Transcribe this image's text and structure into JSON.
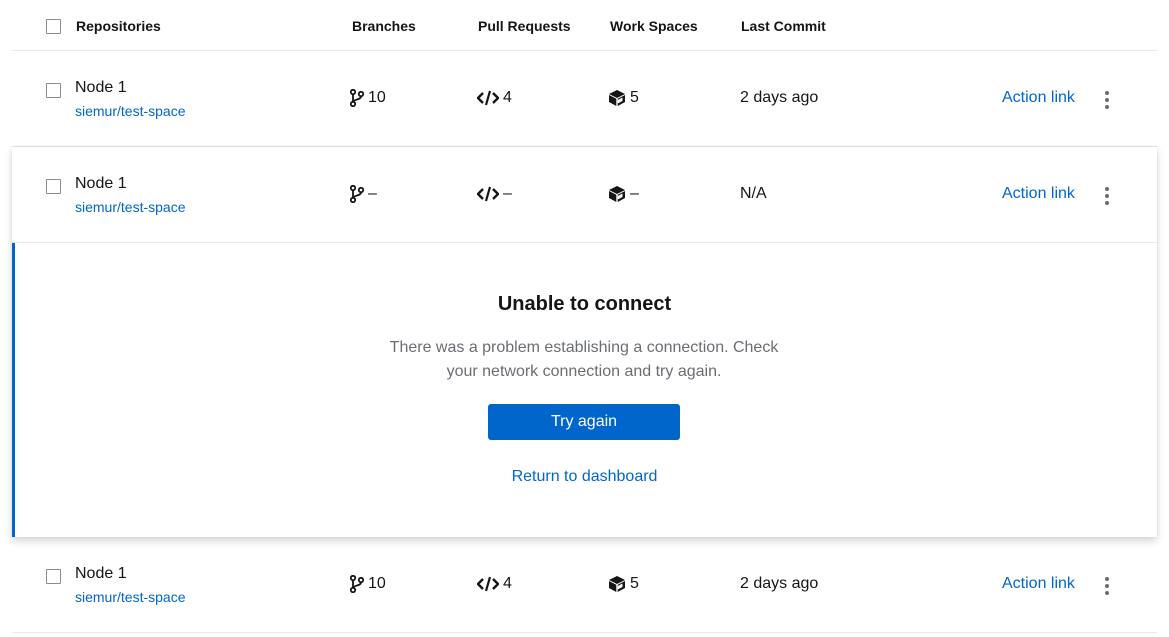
{
  "header": {
    "col_repositories": "Repositories",
    "col_branches": "Branches",
    "col_pull_requests": "Pull Requests",
    "col_work_spaces": "Work Spaces",
    "col_last_commit": "Last Commit"
  },
  "rows": [
    {
      "name": "Node 1",
      "repo": "siemur/test-space",
      "branches": "10",
      "pull_requests": "4",
      "work_spaces": "5",
      "last_commit": "2 days ago",
      "action": "Action link"
    },
    {
      "name": "Node 1",
      "repo": "siemur/test-space",
      "branches": "–",
      "pull_requests": "–",
      "work_spaces": "–",
      "last_commit": "N/A",
      "action": "Action link"
    },
    {
      "name": "Node 1",
      "repo": "siemur/test-space",
      "branches": "10",
      "pull_requests": "4",
      "work_spaces": "5",
      "last_commit": "2 days ago",
      "action": "Action link"
    }
  ],
  "empty_state": {
    "title": "Unable to connect",
    "body": "There was a problem establishing a connection. Check your network connection and try again.",
    "primary_button": "Try again",
    "secondary_link": "Return to dashboard"
  },
  "icons": {
    "branch": "code-branch-icon",
    "pull_request": "code-icon",
    "workspace": "cube-icon",
    "kebab": "kebab-menu-icon"
  },
  "colors": {
    "link": "#0066cc",
    "accent": "#0066cc",
    "text": "#151515",
    "muted": "#6a6e73"
  }
}
